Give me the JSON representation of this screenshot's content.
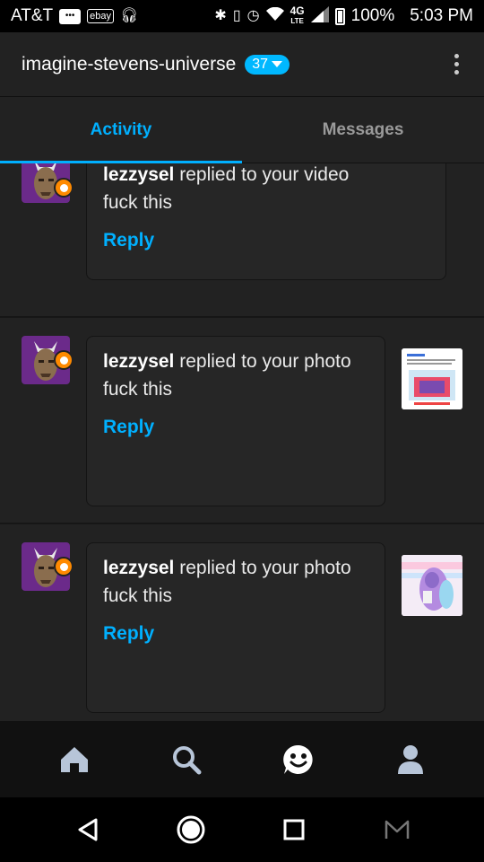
{
  "status_bar": {
    "carrier": "AT&T",
    "ebay_label": "ebay",
    "network": "4G",
    "network_sub": "LTE",
    "battery": "100%",
    "time": "5:03 PM"
  },
  "header": {
    "blog_name": "imagine-stevens-universe",
    "badge_count": "37"
  },
  "tabs": [
    {
      "label": "Activity",
      "active": true
    },
    {
      "label": "Messages",
      "active": false
    }
  ],
  "feed": {
    "items": [
      {
        "user": "lezzysel",
        "action": "replied to your video",
        "text": "fuck this",
        "reply_label": "Reply"
      },
      {
        "user": "lezzysel",
        "action": "replied to your photo",
        "text": "fuck this",
        "reply_label": "Reply"
      },
      {
        "user": "lezzysel",
        "action": "replied to your photo",
        "text": "fuck this",
        "reply_label": "Reply"
      }
    ]
  },
  "colors": {
    "accent": "#00b0ff",
    "badge": "#00b8ff",
    "notif_dot": "#ff8a00",
    "background": "#222222"
  },
  "bottom_nav": [
    "home-icon",
    "search-icon",
    "activity-smiley-icon",
    "account-icon"
  ],
  "system_nav": [
    "back-icon",
    "home-circle-icon",
    "recents-icon",
    "gmail-icon"
  ]
}
